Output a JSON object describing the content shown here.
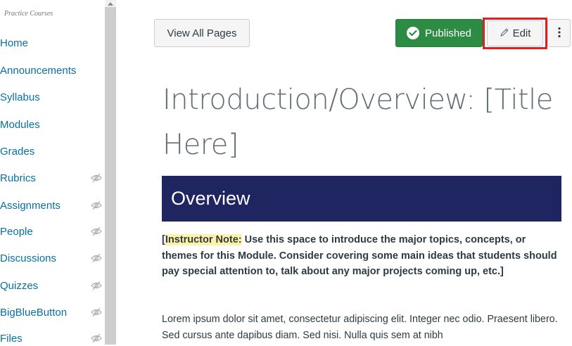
{
  "sidebar": {
    "course_title": "Practice Courses",
    "items": [
      {
        "label": "Home",
        "hidden": false
      },
      {
        "label": "Announcements",
        "hidden": false
      },
      {
        "label": "Syllabus",
        "hidden": false
      },
      {
        "label": "Modules",
        "hidden": false
      },
      {
        "label": "Grades",
        "hidden": false
      },
      {
        "label": "Rubrics",
        "hidden": true
      },
      {
        "label": "Assignments",
        "hidden": true
      },
      {
        "label": "People",
        "hidden": true
      },
      {
        "label": "Discussions",
        "hidden": true
      },
      {
        "label": "Quizzes",
        "hidden": true
      },
      {
        "label": "BigBlueButton",
        "hidden": true
      },
      {
        "label": "Files",
        "hidden": true
      }
    ]
  },
  "toolbar": {
    "view_all_label": "View All Pages",
    "published_label": "Published",
    "edit_label": "Edit",
    "more_icon": "kebab-menu-icon"
  },
  "page": {
    "title": "Introduction/Overview: [Title Here]",
    "banner_heading": "Overview",
    "note_open": "[",
    "note_label": "Instructor Note:",
    "note_body": " Use this space to introduce the major topics, concepts, or themes for this Module. Consider covering some main ideas that students should pay special attention to, talk about any major projects coming up, etc.]",
    "lorem": "Lorem ipsum dolor sit amet, consectetur adipiscing elit. Integer nec odio. Praesent libero. Sed cursus ante dapibus diam. Sed nisi. Nulla quis sem at nibh"
  },
  "colors": {
    "link": "#0770a3",
    "published": "#2c8c43",
    "banner": "#1e2561",
    "highlight_box": "#e02020",
    "note_highlight": "#fdf3a7"
  }
}
